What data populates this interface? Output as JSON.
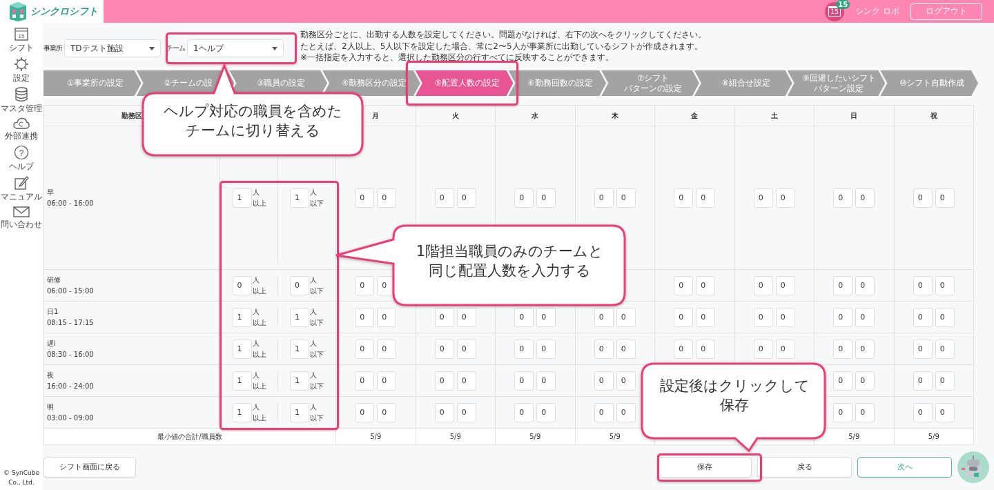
{
  "header": {
    "logo": "シンクロシフト",
    "calendar_icon_text": "15",
    "badge": "15",
    "user": "シンク ロボ",
    "logout": "ログアウト"
  },
  "sidebar": {
    "items": [
      {
        "label": "シフト",
        "icon_text": "15"
      },
      {
        "label": "設定"
      },
      {
        "label": "マスタ管理"
      },
      {
        "label": "外部連携"
      },
      {
        "label": "ヘルプ",
        "icon_text": "?"
      },
      {
        "label": "マニュアル"
      },
      {
        "label": "問い合わせ"
      }
    ],
    "copyright": [
      "© SynCube",
      "Co., Ltd."
    ]
  },
  "filters": [
    {
      "label": "事業所",
      "value": "TDテスト施設"
    },
    {
      "label": "チーム",
      "value": "1ヘルプ"
    }
  ],
  "instructions": [
    "勤務区分ごとに、出勤する人数を設定してください。問題がなければ、右下の次へをクリックしてください。",
    "たとえば、2人以上、5人以下を設定した場合、常に2〜5人が事業所に出勤しているシフトが作成されます。",
    "※一括指定を入力すると、選択した勤務区分の行すべてに反映することができます。"
  ],
  "steps": [
    {
      "lines": [
        "①事業所の設定"
      ],
      "selected": false
    },
    {
      "lines": [
        "②チームの設"
      ],
      "selected": false
    },
    {
      "lines": [
        "③職員の設定"
      ],
      "selected": false
    },
    {
      "lines": [
        "④勤務区分の設定"
      ],
      "selected": false
    },
    {
      "lines": [
        "⑤配置人数の設定"
      ],
      "selected": true
    },
    {
      "lines": [
        "⑥勤務回数の設定"
      ],
      "selected": false
    },
    {
      "lines": [
        "⑦シフト",
        "パターンの設定"
      ],
      "selected": false
    },
    {
      "lines": [
        "⑧組合せ設定"
      ],
      "selected": false
    },
    {
      "lines": [
        "⑨回避したいシフト",
        "パターン設定"
      ],
      "selected": false
    },
    {
      "lines": [
        "⑩シフト自動作成"
      ],
      "selected": false
    }
  ],
  "table": {
    "columns": [
      "勤務区",
      "月",
      "火",
      "水",
      "木",
      "金",
      "土",
      "日",
      "祝"
    ],
    "rows": [
      {
        "name": "早",
        "time": "06:00 - 16:00",
        "min": {
          "value": "1",
          "unit": "人",
          "note": "以上"
        },
        "max": {
          "value": "1",
          "unit": "人",
          "note": "以下"
        },
        "days": [
          {
            "kind": "inputs",
            "values": [
              "0",
              "0"
            ]
          },
          {
            "kind": "inputs",
            "values": [
              "0",
              "0"
            ]
          },
          {
            "kind": "inputs",
            "values": [
              "0",
              "0"
            ]
          },
          {
            "kind": "inputs",
            "values": [
              "0",
              "0"
            ]
          },
          {
            "kind": "inputs",
            "values": [
              "0",
              "0"
            ]
          },
          {
            "kind": "inputs",
            "values": [
              "0",
              "0"
            ]
          },
          {
            "kind": "inputs",
            "values": [
              "0",
              "0"
            ]
          },
          {
            "kind": "inputs",
            "values": [
              "0",
              "0"
            ]
          }
        ]
      },
      {
        "name": "研修",
        "time": "06:00 - 15:00",
        "min": {
          "value": "0",
          "unit": "人",
          "note": "以上"
        },
        "max": {
          "value": "0",
          "unit": "人",
          "note": "以下"
        },
        "days": [
          {
            "kind": "inputs",
            "values": [
              "0",
              "0"
            ]
          },
          {
            "kind": "covered"
          },
          {
            "kind": "covered"
          },
          {
            "kind": "empty"
          },
          {
            "kind": "inputs",
            "values": [
              "0",
              "0"
            ]
          },
          {
            "kind": "inputs",
            "values": [
              "0",
              "0"
            ]
          },
          {
            "kind": "inputs",
            "values": [
              "0",
              "0"
            ]
          },
          {
            "kind": "inputs",
            "values": [
              "0",
              "0"
            ]
          }
        ]
      },
      {
        "name": "日1",
        "time": "08:15 - 17:15",
        "min": {
          "value": "1",
          "unit": "人",
          "note": "以上"
        },
        "max": {
          "value": "1",
          "unit": "人",
          "note": "以下"
        },
        "days": [
          {
            "kind": "inputs",
            "values": [
              "0",
              "0"
            ]
          },
          {
            "kind": "inputs",
            "values": [
              "0",
              "0"
            ]
          },
          {
            "kind": "inputs",
            "values": [
              "0",
              "0"
            ]
          },
          {
            "kind": "inputs",
            "values": [
              "0",
              "0"
            ]
          },
          {
            "kind": "inputs",
            "values": [
              "0",
              "0"
            ]
          },
          {
            "kind": "inputs",
            "values": [
              "0",
              "0"
            ]
          },
          {
            "kind": "inputs",
            "values": [
              "0",
              "0"
            ]
          },
          {
            "kind": "inputs",
            "values": [
              "0",
              "0"
            ]
          }
        ]
      },
      {
        "name": "遅i",
        "time": "08:30 - 16:00",
        "min": {
          "value": "1",
          "unit": "人",
          "note": "以上"
        },
        "max": {
          "value": "1",
          "unit": "人",
          "note": "以下"
        },
        "days": [
          {
            "kind": "inputs",
            "values": [
              "0",
              "0"
            ]
          },
          {
            "kind": "inputs",
            "values": [
              "0",
              "0"
            ]
          },
          {
            "kind": "inputs",
            "values": [
              "0",
              "0"
            ]
          },
          {
            "kind": "inputs",
            "values": [
              "0",
              "0"
            ]
          },
          {
            "kind": "inputs",
            "values": [
              "0",
              "0"
            ]
          },
          {
            "kind": "inputs",
            "values": [
              "0",
              "0"
            ]
          },
          {
            "kind": "inputs",
            "values": [
              "0",
              "0"
            ]
          },
          {
            "kind": "inputs",
            "values": [
              "0",
              "0"
            ]
          }
        ]
      },
      {
        "name": "夜",
        "time": "16:00 - 24:00",
        "min": {
          "value": "1",
          "unit": "人",
          "note": "以上"
        },
        "max": {
          "value": "1",
          "unit": "人",
          "note": "以下"
        },
        "days": [
          {
            "kind": "inputs",
            "values": [
              "0",
              "0"
            ]
          },
          {
            "kind": "inputs",
            "values": [
              "0",
              "0"
            ]
          },
          {
            "kind": "inputs",
            "values": [
              "0",
              "0"
            ]
          },
          {
            "kind": "inputs",
            "values": [
              "0",
              "0"
            ]
          },
          {
            "kind": "covered"
          },
          {
            "kind": "covered"
          },
          {
            "kind": "inputs",
            "values": [
              "0",
              "0"
            ]
          },
          {
            "kind": "inputs",
            "values": [
              "0",
              "0"
            ]
          }
        ]
      },
      {
        "name": "明",
        "time": "03:00 - 09:00",
        "min": {
          "value": "1",
          "unit": "人",
          "note": "以上"
        },
        "max": {
          "value": "1",
          "unit": "人",
          "note": "以下"
        },
        "days": [
          {
            "kind": "inputs",
            "values": [
              "0",
              "0"
            ]
          },
          {
            "kind": "inputs",
            "values": [
              "0",
              "0"
            ]
          },
          {
            "kind": "inputs",
            "values": [
              "0",
              "0"
            ]
          },
          {
            "kind": "inputs",
            "values": [
              "0",
              "0"
            ]
          },
          {
            "kind": "covered"
          },
          {
            "kind": "covered"
          },
          {
            "kind": "inputs",
            "values": [
              "0",
              "0"
            ]
          },
          {
            "kind": "inputs",
            "values": [
              "0",
              "0"
            ]
          }
        ]
      }
    ],
    "total": {
      "label": "最小値の合計/職員数",
      "values": [
        {
          "kind": "text",
          "value": "5/9"
        },
        {
          "kind": "text",
          "value": "5/9"
        },
        {
          "kind": "text",
          "value": "5/9"
        },
        {
          "kind": "text",
          "value": "5/9"
        },
        {
          "kind": "empty"
        },
        {
          "kind": "empty"
        },
        {
          "kind": "text",
          "value": "5/9"
        },
        {
          "kind": "text",
          "value": "5/9"
        }
      ]
    }
  },
  "buttons": {
    "back_to_shift": "シフト画面に戻る",
    "save": "保存",
    "back": "戻る",
    "next": "次へ"
  },
  "callouts": [
    {
      "lines": [
        "ヘルプ対応の職員を含めた",
        "チームに切り替える"
      ]
    },
    {
      "lines": [
        "1階担当職員のみのチームと",
        "同じ配置人数を入力する"
      ]
    },
    {
      "lines": [
        "設定後はクリックして",
        "保存"
      ]
    }
  ]
}
